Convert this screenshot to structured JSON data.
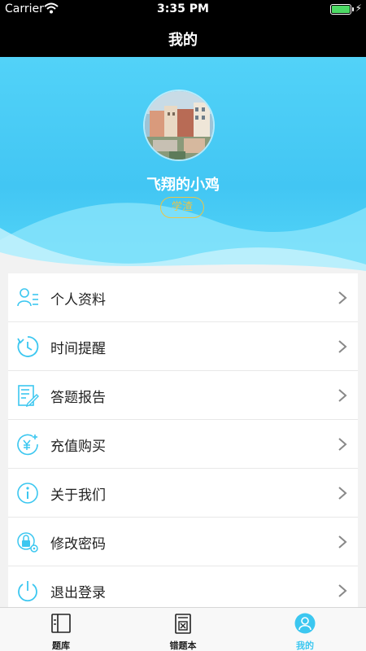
{
  "status_bar": {
    "carrier": "Carrier",
    "time": "3:35 PM"
  },
  "nav": {
    "title": "我的"
  },
  "profile": {
    "username": "飞翔的小鸡",
    "badge": "学渣"
  },
  "menu": [
    {
      "label": "个人资料",
      "icon": "person-list-icon"
    },
    {
      "label": "时间提醒",
      "icon": "clock-icon"
    },
    {
      "label": "答题报告",
      "icon": "report-icon"
    },
    {
      "label": "充值购买",
      "icon": "yen-coin-icon"
    },
    {
      "label": "关于我们",
      "icon": "info-icon"
    },
    {
      "label": "修改密码",
      "icon": "lock-gear-icon"
    },
    {
      "label": "退出登录",
      "icon": "power-icon"
    }
  ],
  "tabs": [
    {
      "label": "题库",
      "icon": "book-icon",
      "active": false
    },
    {
      "label": "错题本",
      "icon": "wrong-book-icon",
      "active": false
    },
    {
      "label": "我的",
      "icon": "user-icon",
      "active": true
    }
  ],
  "colors": {
    "accent": "#3cc7f0",
    "header_gradient_top": "#52d2f8",
    "badge": "#e9c54a"
  }
}
